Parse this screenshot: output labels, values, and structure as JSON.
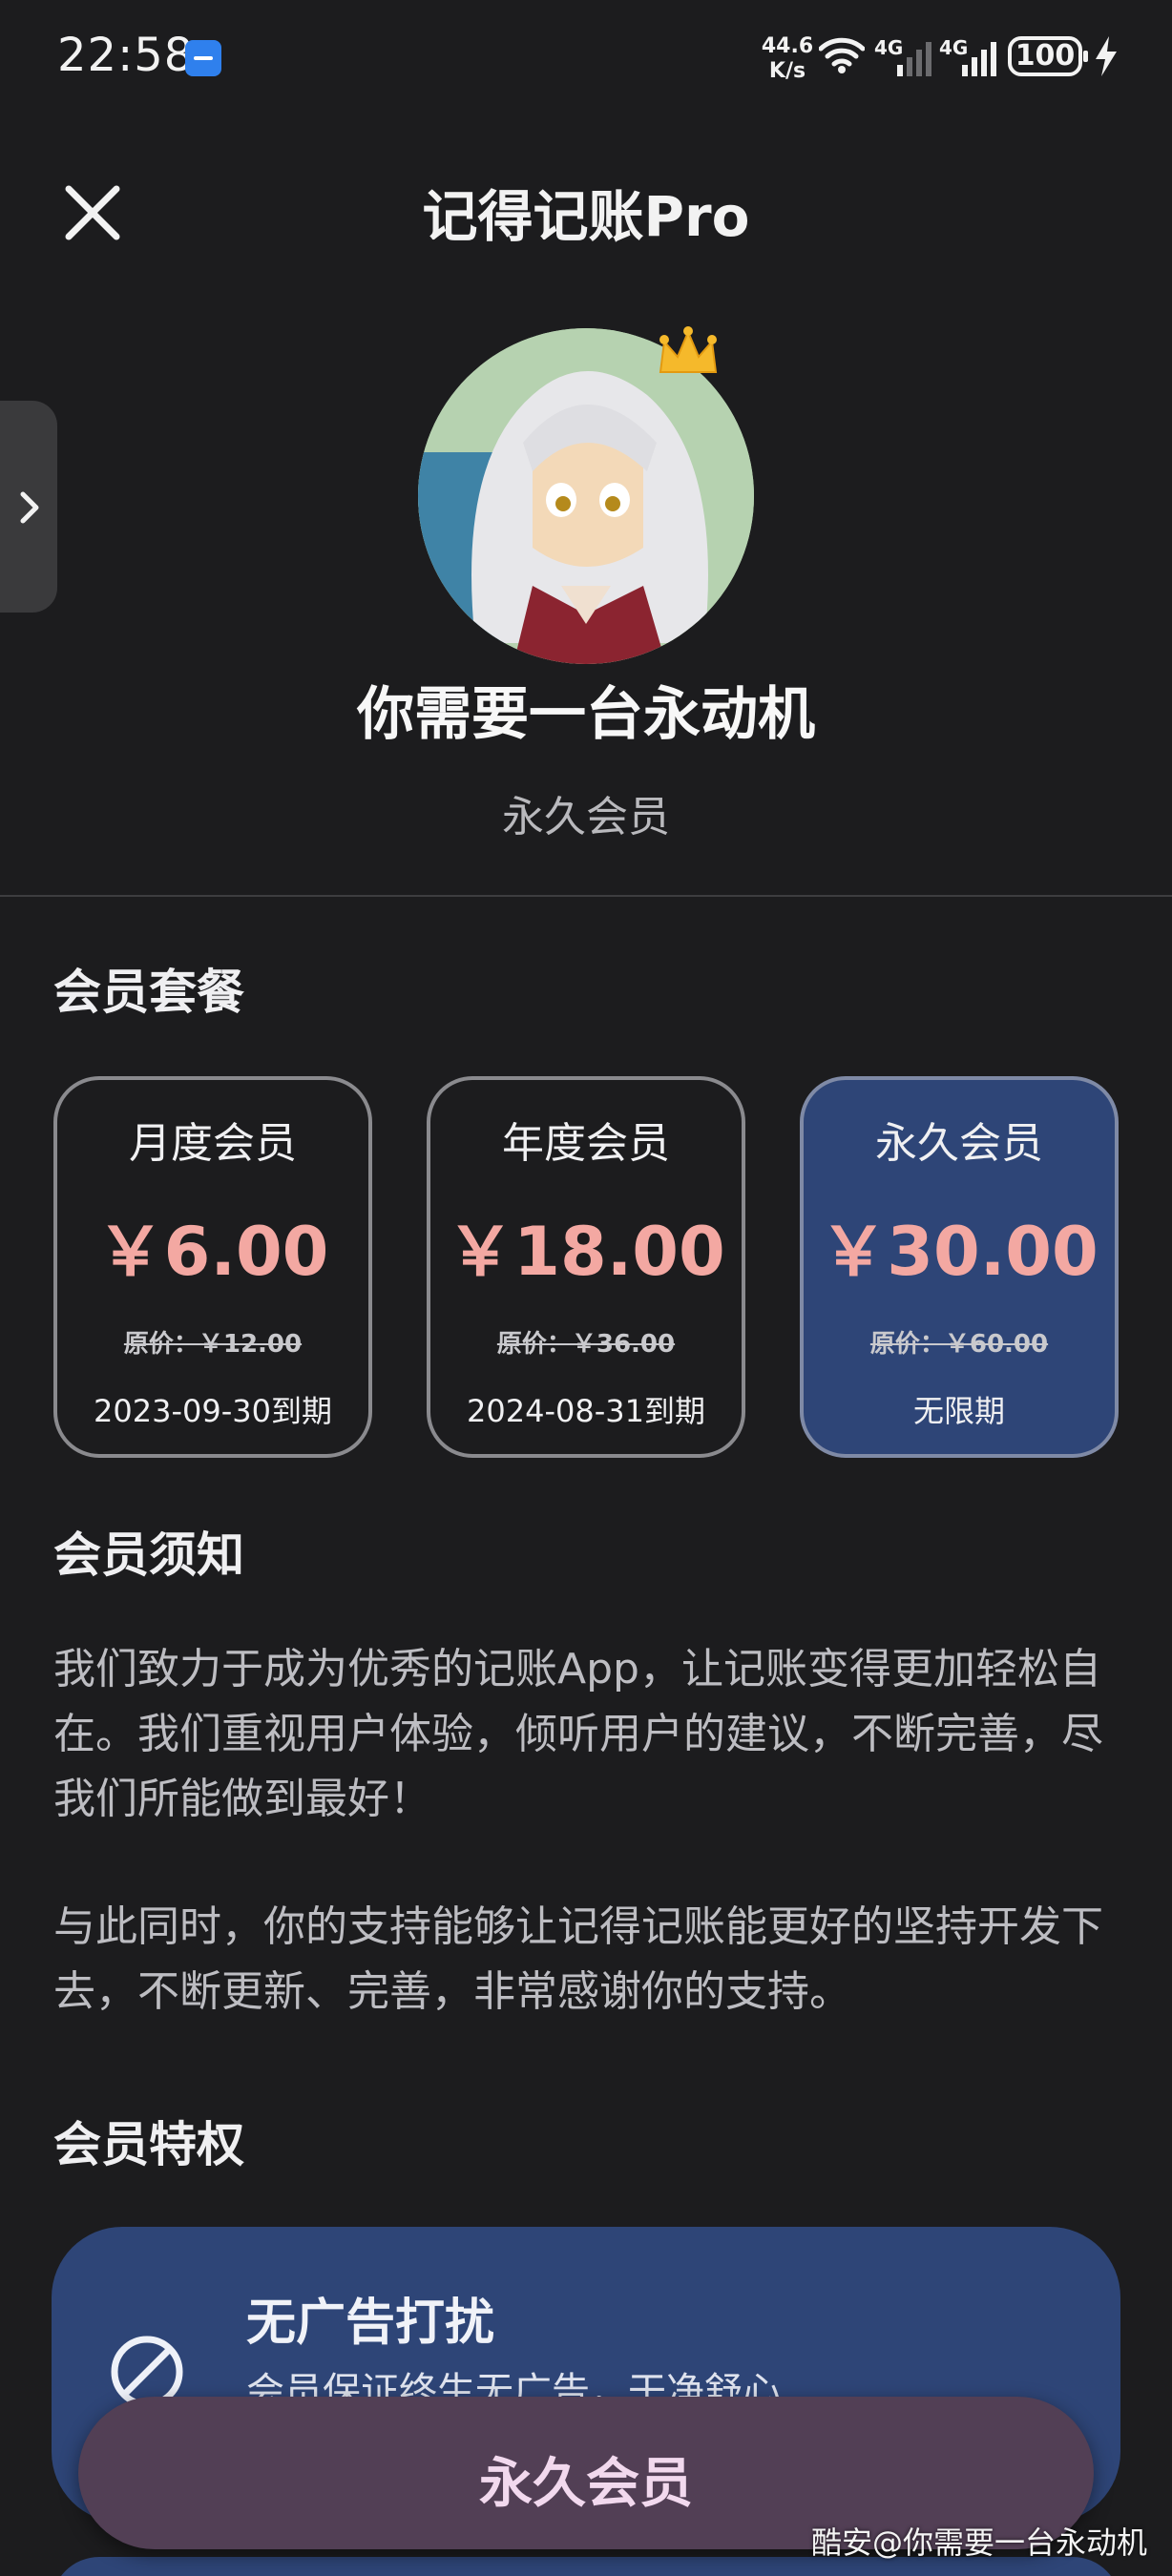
{
  "status_bar": {
    "time": "22:58",
    "net_speed_value": "44.6",
    "net_speed_unit": "K/s",
    "signal1_label": "4G",
    "signal2_label": "4G",
    "battery": "100"
  },
  "header": {
    "title": "记得记账Pro"
  },
  "profile": {
    "name": "你需要一台永动机",
    "tier": "永久会员"
  },
  "plans_section": {
    "title": "会员套餐",
    "plans": [
      {
        "name": "月度会员",
        "price": "￥6.00",
        "original": "原价：￥12.00",
        "expiry": "2023-09-30到期",
        "selected": false
      },
      {
        "name": "年度会员",
        "price": "￥18.00",
        "original": "原价：￥36.00",
        "expiry": "2024-08-31到期",
        "selected": false
      },
      {
        "name": "永久会员",
        "price": "￥30.00",
        "original": "原价：￥60.00",
        "expiry": "无限期",
        "selected": true
      }
    ]
  },
  "notice_section": {
    "title": "会员须知",
    "paragraph1": "我们致力于成为优秀的记账App，让记账变得更加轻松自在。我们重视用户体验，倾听用户的建议，不断完善，尽我们所能做到最好！",
    "paragraph2": "与此同时，你的支持能够让记得记账能更好的坚持开发下去，不断更新、完善，非常感谢你的支持。"
  },
  "privileges_section": {
    "title": "会员特权",
    "perks": [
      {
        "title": "无广告打扰",
        "desc": "会员保证终生无广告，干净舒心"
      }
    ]
  },
  "buy_button": {
    "label": "永久会员"
  },
  "watermark": "酷安@你需要一台永动机",
  "colors": {
    "background": "#1c1c1e",
    "selected_card": "#2e4577",
    "price": "#f3a8a2",
    "buy_button": "#523f55"
  }
}
